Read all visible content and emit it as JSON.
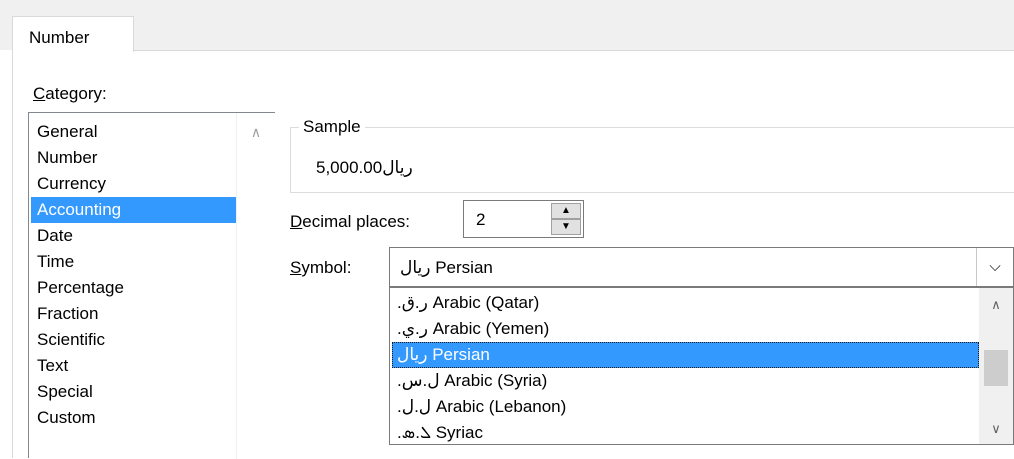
{
  "tabs": {
    "active": "Number"
  },
  "category": {
    "label_accel": "C",
    "label_rest": "ategory:",
    "items": [
      "General",
      "Number",
      "Currency",
      "Accounting",
      "Date",
      "Time",
      "Percentage",
      "Fraction",
      "Scientific",
      "Text",
      "Special",
      "Custom"
    ],
    "selected": "Accounting"
  },
  "sample": {
    "title": "Sample",
    "value": "ریال5,000.00"
  },
  "decimal_places": {
    "label_accel": "D",
    "label_rest": "ecimal places:",
    "value": "2"
  },
  "symbol": {
    "label_accel": "S",
    "label_rest": "ymbol:",
    "value": "ریال Persian",
    "options": [
      "ر.ق.‏ Arabic (Qatar)",
      "ر.ي.‏ Arabic (Yemen)",
      "ریال Persian",
      "ل.س.‏ Arabic (Syria)",
      "ل.ل.‏ Arabic (Lebanon)",
      "ܠ.ܣ.‏ Syriac"
    ],
    "selected": "ریال Persian"
  },
  "icons": {
    "spin_up": "spin-up-arrow",
    "spin_down": "spin-down-arrow",
    "dropdown": "chevron-down",
    "scroll_up": "chevron-up",
    "scroll_down": "chevron-down"
  },
  "colors": {
    "selection": "#3399ff",
    "selection_text": "#ffffff"
  }
}
